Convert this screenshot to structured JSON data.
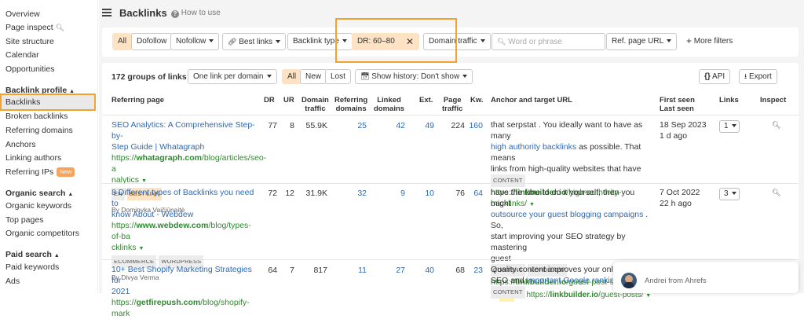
{
  "sidebar": {
    "top_items": [
      "Overview",
      "Page inspect",
      "Site structure",
      "Calendar",
      "Opportunities"
    ],
    "backlink_profile": {
      "heading": "Backlink profile",
      "items": [
        "Backlinks",
        "Broken backlinks",
        "Referring domains",
        "Anchors",
        "Linking authors",
        "Referring IPs"
      ],
      "new_badge": "New"
    },
    "organic_search": {
      "heading": "Organic search",
      "items": [
        "Organic keywords",
        "Top pages",
        "Organic competitors"
      ]
    },
    "paid_search": {
      "heading": "Paid search",
      "items": [
        "Paid keywords",
        "Ads"
      ]
    }
  },
  "header": {
    "title": "Backlinks",
    "how_to_use": "How to use"
  },
  "filters": {
    "all": "All",
    "dofollow": "Dofollow",
    "nofollow": "Nofollow",
    "best_links": "Best links",
    "backlink_type": "Backlink type",
    "dr_chip": "DR: 60–80",
    "domain_traffic": "Domain traffic",
    "search_placeholder": "Word or phrase",
    "ref_page_url": "Ref. page URL",
    "more_filters": "More filters"
  },
  "toolbar": {
    "groups_count": "172 groups of links",
    "grouping": "One link per domain",
    "seg_all": "All",
    "seg_new": "New",
    "seg_lost": "Lost",
    "show_history": "Show history: Don't show",
    "api": "API",
    "export": "Export"
  },
  "table": {
    "headers": {
      "referring_page": "Referring page",
      "dr": "DR",
      "ur": "UR",
      "domain_traffic_1": "Domain",
      "domain_traffic_2": "traffic",
      "ref_domains_1": "Referring",
      "ref_domains_2": "domains",
      "linked_domains_1": "Linked",
      "linked_domains_2": "domains",
      "ext": "Ext.",
      "page_traffic_1": "Page",
      "page_traffic_2": "traffic",
      "kw": "Kw.",
      "anchor": "Anchor and target URL",
      "first_seen": "First seen",
      "last_seen": "Last seen",
      "links": "Links",
      "inspect": "Inspect"
    },
    "rows": [
      {
        "title_line1": "SEO Analytics: A Comprehensive Step-by-",
        "title_line2": "Step Guide | Whatagraph",
        "url_prefix": "https://",
        "url_domain": "whatagraph.com",
        "url_path1": "/blog/articles/seo-a",
        "url_path2": "nalytics",
        "tags": [
          "EN",
          "BEST LINK"
        ],
        "author": "By Dominyka Vaičiūnaitė",
        "dr": "77",
        "ur": "8",
        "domain_traffic": "55.9K",
        "ref_domains": "25",
        "linked_domains": "42",
        "ext": "49",
        "page_traffic": "224",
        "kw": "160",
        "anchor_line1": "that serpstat . You ideally want to have as many",
        "anchor_link": "high authority backlinks",
        "anchor_line2": " as possible. That means",
        "anchor_line3": "links from high-quality websites that have",
        "anchor_tags": [
          "CONTENT"
        ],
        "target_prefix": "https://",
        "target_domain": "linkbuilder.io",
        "target_path": "/high-authority-backlinks/",
        "first_seen": "18 Sep 2023",
        "last_seen": "1 d ago",
        "links": "1"
      },
      {
        "title_line1": "8 Different types of Backlinks you need to",
        "title_line2": "know About - Webdew",
        "url_prefix": "https://",
        "url_domain": "www.webdew.com",
        "url_path1": "/blog/types-of-ba",
        "url_path2": "cklinks",
        "tags": [
          "ECOMMERCE",
          "WORDPRESS"
        ],
        "author": "By Divya Verma",
        "dr": "72",
        "ur": "12",
        "domain_traffic": "31.9K",
        "ref_domains": "32",
        "linked_domains": "9",
        "ext": "10",
        "page_traffic": "76",
        "kw": "64",
        "anchor_line1": "have the time to do it yourself, then you might",
        "anchor_link": "outsource your guest blogging campaigns",
        "anchor_line2": " . So,",
        "anchor_line3": "start improving your SEO strategy by mastering",
        "anchor_line4": "guest",
        "anchor_tags": [
          "CONTENT",
          "NOFOLLOW"
        ],
        "target_prefix": "https://",
        "target_domain": "linkbuilder.io",
        "target_path": "/guest-post-service/",
        "redirect_code": "301",
        "redirect_prefix": "https://",
        "redirect_domain": "linkbuilder.io",
        "redirect_path": "/guest-posts/",
        "first_seen": "7 Oct 2022",
        "last_seen": "22 h ago",
        "links": "3"
      },
      {
        "title_line1": "10+ Best Shopify Marketing Strategies for",
        "title_line2": "2021",
        "url_prefix": "https://",
        "url_domain": "getfirepush.com",
        "url_path1": "/blog/shopify-mark",
        "dr": "64",
        "ur": "7",
        "domain_traffic": "817",
        "ref_domains": "11",
        "linked_domains": "27",
        "ext": "40",
        "page_traffic": "68",
        "kw": "23",
        "anchor_line1": "Quality content improves your online",
        "anchor_line2a": "SEO and ",
        "anchor_link": "important Google ranking f",
        "anchor_tags": [
          "CONTENT"
        ]
      }
    ]
  },
  "chat": {
    "from": "Andrei from Ahrefs"
  },
  "colors": {
    "highlight": "#f0a330",
    "link": "#2d6ab5",
    "url_green": "#2a8c2a",
    "chip_bg": "#fde3c3"
  }
}
